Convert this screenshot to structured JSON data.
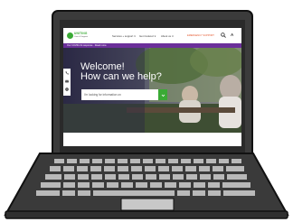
{
  "brand": {
    "logo_name": "UNITING",
    "logo_sub": "Care & Support"
  },
  "nav": {
    "items": [
      "Services + support ∨",
      "Get involved ∨",
      "About us ∨"
    ],
    "emergency": "EMERGENCY SUPPORT",
    "font_control": "A"
  },
  "alert": {
    "text": "Our COVID-19 response · Read more"
  },
  "hero": {
    "title": "Welcome!",
    "subtitle": "How can we help?",
    "search_placeholder": "I'm looking for information on"
  },
  "colors": {
    "brand_green": "#3aaa35",
    "alert_purple": "#6b2f9a",
    "emergency_orange": "#e4572e"
  },
  "icons": [
    "search-icon",
    "arrow-right-icon",
    "phone-icon",
    "mail-icon",
    "location-icon"
  ]
}
